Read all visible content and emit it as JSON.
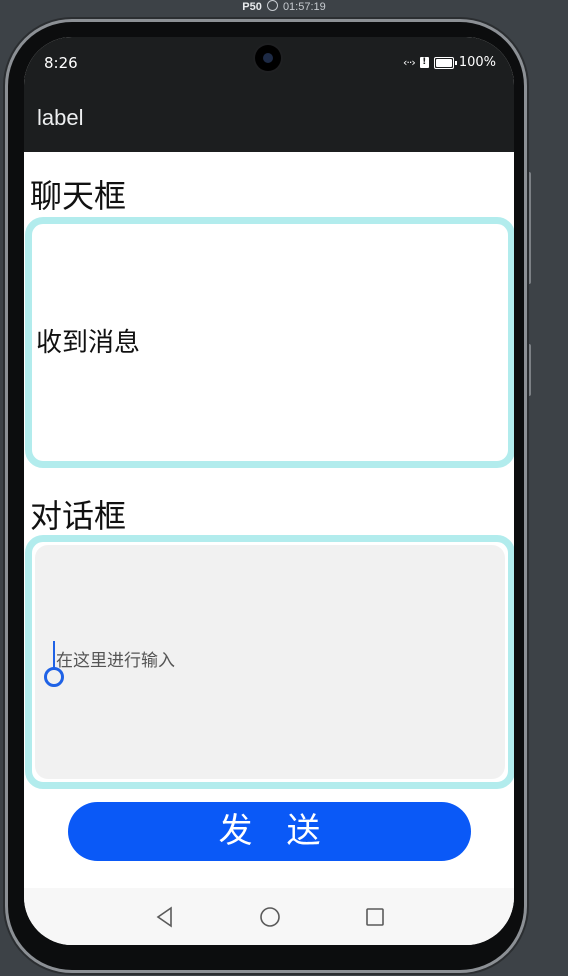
{
  "device": {
    "model": "P50",
    "time": "01:57:19"
  },
  "status_bar": {
    "time": "8:26",
    "battery": "100%",
    "nfc_icon": "nfc-icon",
    "sim_icon": "sim-icon",
    "battery_icon": "battery-icon"
  },
  "app_bar": {
    "title": "label"
  },
  "chat_section": {
    "title": "聊天框",
    "received_message": "收到消息"
  },
  "dialog_section": {
    "title": "对话框",
    "input_value": "",
    "input_placeholder": "在这里进行输入"
  },
  "send_button": {
    "label": "发　送"
  },
  "nav_bar": {
    "back_icon": "back-triangle-icon",
    "home_icon": "home-circle-icon",
    "recent_icon": "recent-square-icon"
  },
  "colors": {
    "accent": "#0a59f7",
    "box_border": "#b2eced",
    "input_bg": "#f1f1f1",
    "app_bar_bg": "#1c1e1f"
  }
}
